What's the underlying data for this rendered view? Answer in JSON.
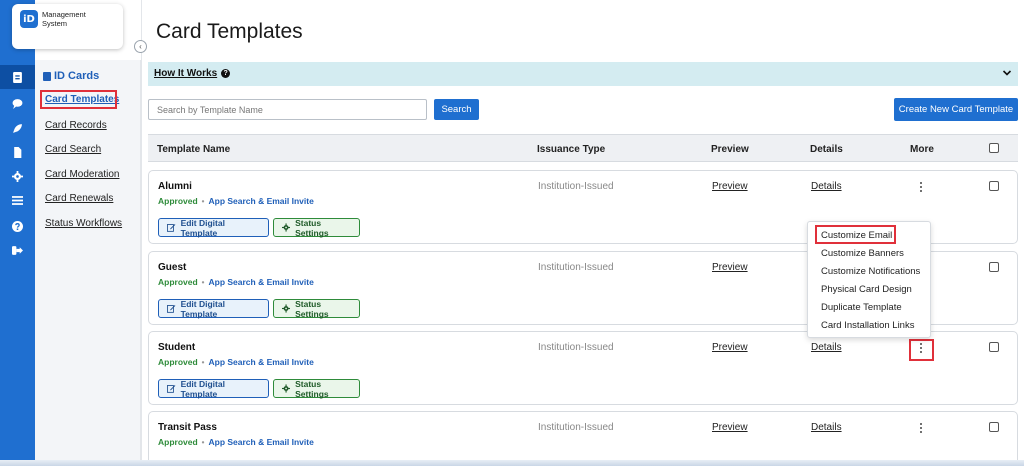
{
  "app": {
    "logo_mark": "iD",
    "logo_text_line1": "Management",
    "logo_text_line2": "System"
  },
  "rail": {
    "icons": [
      "id-card-icon",
      "chat-icon",
      "rocket-icon",
      "document-icon",
      "gear-icon",
      "list-icon",
      "help-icon",
      "logout-icon"
    ]
  },
  "sidebar": {
    "heading": "ID Cards",
    "items": [
      {
        "label": "Card Templates",
        "active": true
      },
      {
        "label": "Card Records"
      },
      {
        "label": "Card Search"
      },
      {
        "label": "Card Moderation"
      },
      {
        "label": "Card Renewals"
      },
      {
        "label": "Status Workflows"
      }
    ]
  },
  "main": {
    "title": "Card Templates",
    "how_it_works": "How It Works",
    "search_placeholder": "Search by Template Name",
    "search_button": "Search",
    "create_button": "Create New Card Template"
  },
  "table": {
    "headers": [
      "Template Name",
      "Issuance Type",
      "Preview",
      "Details",
      "More"
    ],
    "rows": [
      {
        "name": "Alumni",
        "status": "Approved",
        "invite": "App Search & Email Invite",
        "issuance": "Institution-Issued",
        "preview": "Preview",
        "details": "Details",
        "edit_label": "Edit Digital Template",
        "status_label": "Status Settings"
      },
      {
        "name": "Guest",
        "status": "Approved",
        "invite": "App Search & Email Invite",
        "issuance": "Institution-Issued",
        "preview": "Preview",
        "details": "",
        "edit_label": "Edit Digital Template",
        "status_label": "Status Settings"
      },
      {
        "name": "Student",
        "status": "Approved",
        "invite": "App Search & Email Invite",
        "issuance": "Institution-Issued",
        "preview": "Preview",
        "details": "Details",
        "edit_label": "Edit Digital Template",
        "status_label": "Status Settings"
      },
      {
        "name": "Transit Pass",
        "status": "Approved",
        "invite": "App Search & Email Invite",
        "issuance": "Institution-Issued",
        "preview": "Preview",
        "details": "Details"
      }
    ]
  },
  "more_menu": {
    "items": [
      "Customize Email",
      "Customize Banners",
      "Customize Notifications",
      "Physical Card Design",
      "Duplicate Template",
      "Card Installation Links"
    ]
  },
  "colors": {
    "primary": "#1f6fd0",
    "highlight": "#e0303a",
    "approved": "#2e8b3a",
    "info_bar": "#d4ecf1"
  }
}
